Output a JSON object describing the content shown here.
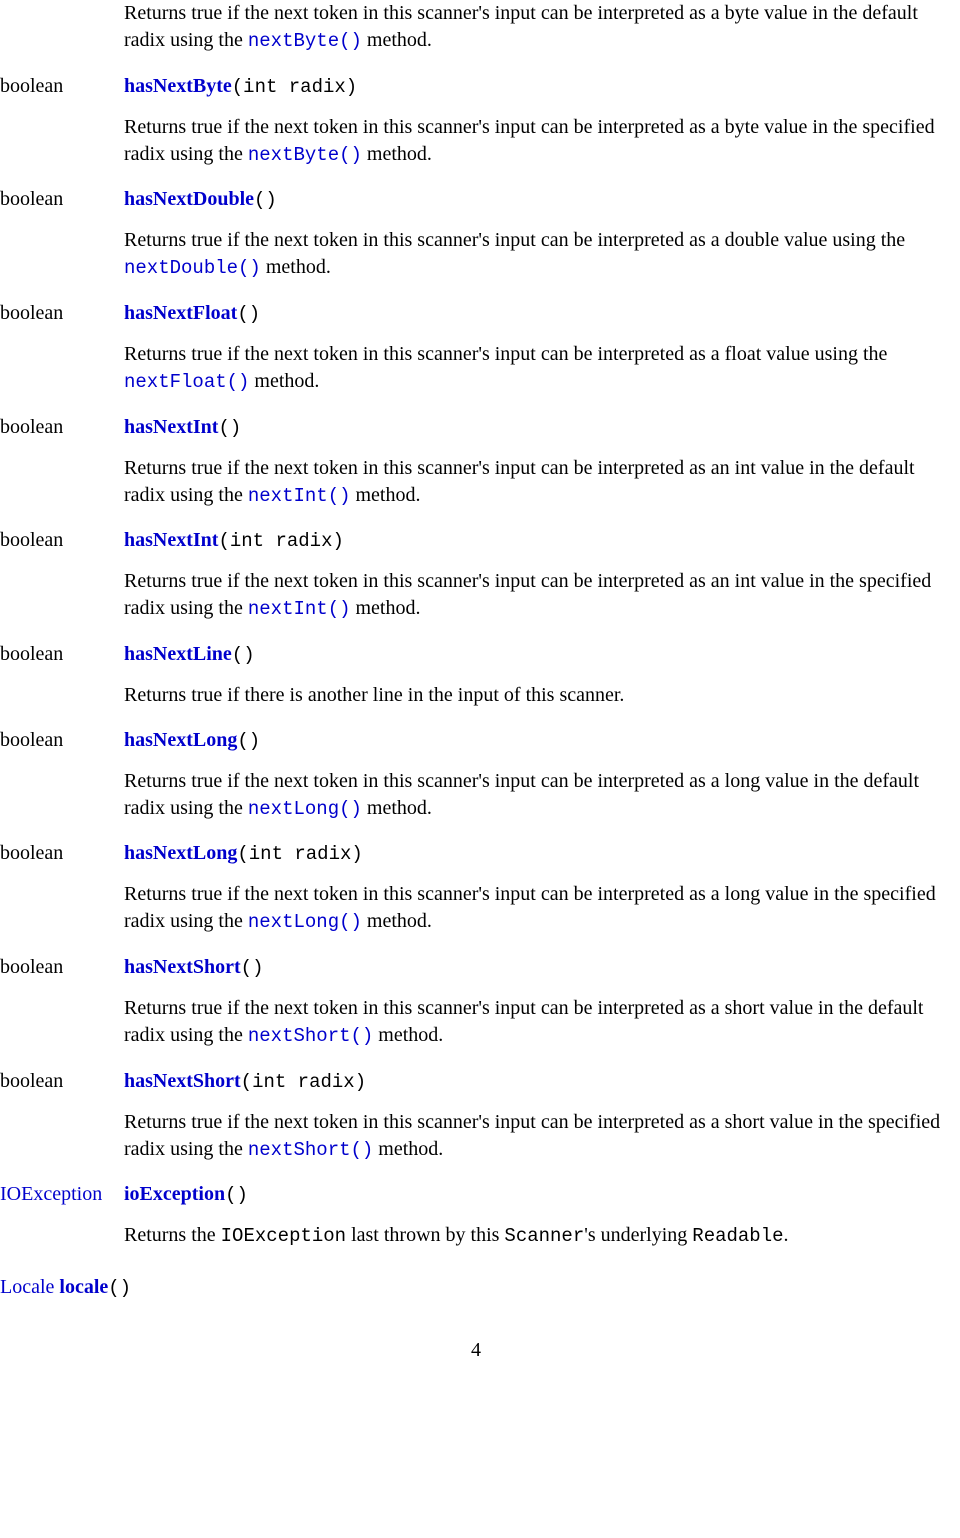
{
  "methods": [
    {
      "type": "",
      "name": "",
      "params": "",
      "desc_pre": "Returns true if the next token in this scanner's input can be interpreted as a byte value in the default radix using the ",
      "desc_mono": "nextByte()",
      "desc_post": " method."
    },
    {
      "type": "boolean",
      "name": "hasNextByte",
      "params": "(int radix)",
      "desc_pre": "Returns true if the next token in this scanner's input can be interpreted as a byte value in the specified radix using the ",
      "desc_mono": "nextByte()",
      "desc_post": " method."
    },
    {
      "type": "boolean",
      "name": "hasNextDouble",
      "params": "()",
      "desc_pre": "Returns true if the next token in this scanner's input can be interpreted as a double value using the ",
      "desc_mono": "nextDouble()",
      "desc_post": " method."
    },
    {
      "type": "boolean",
      "name": "hasNextFloat",
      "params": "()",
      "desc_pre": "Returns true if the next token in this scanner's input can be interpreted as a float value using the ",
      "desc_mono": "nextFloat()",
      "desc_post": " method."
    },
    {
      "type": "boolean",
      "name": "hasNextInt",
      "params": "()",
      "desc_pre": "Returns true if the next token in this scanner's input can be interpreted as an int value in the default radix using the ",
      "desc_mono": "nextInt()",
      "desc_post": " method."
    },
    {
      "type": "boolean",
      "name": "hasNextInt",
      "params": "(int radix)",
      "desc_pre": "Returns true if the next token in this scanner's input can be interpreted as an int value in the specified radix using the ",
      "desc_mono": "nextInt()",
      "desc_post": " method."
    },
    {
      "type": "boolean",
      "name": "hasNextLine",
      "params": "()",
      "desc_pre": "Returns true if there is another line in the input of this scanner.",
      "desc_mono": "",
      "desc_post": ""
    },
    {
      "type": "boolean",
      "name": "hasNextLong",
      "params": "()",
      "desc_pre": "Returns true if the next token in this scanner's input can be interpreted as a long value in the default radix using the ",
      "desc_mono": "nextLong()",
      "desc_post": " method."
    },
    {
      "type": "boolean",
      "name": "hasNextLong",
      "params": "(int radix)",
      "desc_pre": "Returns true if the next token in this scanner's input can be interpreted as a long value in the specified radix using the ",
      "desc_mono": "nextLong()",
      "desc_post": " method."
    },
    {
      "type": "boolean",
      "name": "hasNextShort",
      "params": "()",
      "desc_pre": "Returns true if the next token in this scanner's input can be interpreted as a short value in the default radix using the ",
      "desc_mono": "nextShort()",
      "desc_post": " method."
    },
    {
      "type": "boolean",
      "name": "hasNextShort",
      "params": "(int radix)",
      "desc_pre": "Returns true if the next token in this scanner's input can be interpreted as a short value in the specified radix using the ",
      "desc_mono": "nextShort()",
      "desc_post": " method."
    },
    {
      "type": "IOException",
      "type_link": true,
      "name": "ioException",
      "params": "()",
      "desc_pre": "Returns the ",
      "desc_mono_black": "IOException",
      "desc_mid": " last thrown by this ",
      "desc_mono_black2": "Scanner",
      "desc_mid2": "'s underlying ",
      "desc_mono_black3": "Readable",
      "desc_post": "."
    }
  ],
  "orphan": {
    "type": "Locale",
    "name": "locale",
    "params": "()"
  },
  "page_number": "4"
}
